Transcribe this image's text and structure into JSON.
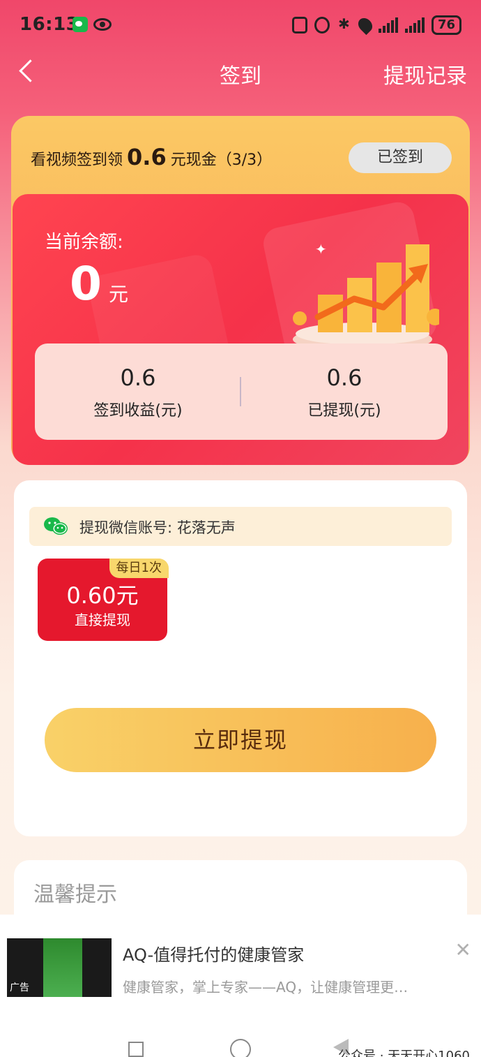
{
  "status": {
    "time": "16:13",
    "battery": "76"
  },
  "nav": {
    "title": "签到",
    "right": "提现记录"
  },
  "sign": {
    "text_prefix": "看视频签到领",
    "amount": "0.6",
    "text_suffix": "元现金（3/3）",
    "button": "已签到"
  },
  "balance": {
    "label": "当前余额:",
    "value": "0",
    "unit": "元"
  },
  "stats": [
    {
      "value": "0.6",
      "label": "签到收益(元)"
    },
    {
      "value": "0.6",
      "label": "已提现(元)"
    }
  ],
  "withdraw": {
    "wechat": "提现微信账号: 花落无声",
    "tile_tag": "每日1次",
    "tile_amount": "0.60元",
    "tile_sub": "直接提现",
    "button": "立即提现"
  },
  "tips": {
    "title": "温馨提示"
  },
  "ad": {
    "thumb_label": "广告",
    "title": "AQ-值得托付的健康管家",
    "desc": "健康管家，掌上专家——AQ，让健康管理更…",
    "close": "✕"
  },
  "watermark": "公众号 · 天天开心1060",
  "colors": {
    "accent_red": "#f5324a",
    "gold": "#f9c864",
    "wechat_green": "#19b84a"
  }
}
